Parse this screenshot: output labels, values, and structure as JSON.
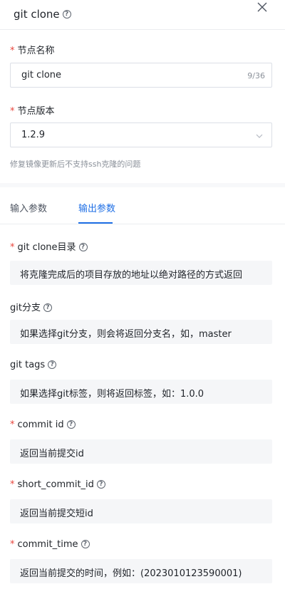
{
  "header": {
    "title": "git clone",
    "help_icon": "help-circle-icon",
    "close_icon": "close-icon"
  },
  "node_name": {
    "label": "节点名称",
    "value": "git clone",
    "count": "9/36"
  },
  "node_version": {
    "label": "节点版本",
    "value": "1.2.9",
    "hint": "修复镜像更新后不支持ssh克隆的问题"
  },
  "tabs": [
    {
      "label": "输入参数",
      "active": false
    },
    {
      "label": "输出参数",
      "active": true
    }
  ],
  "outputs": [
    {
      "label": "git clone目录",
      "required": true,
      "desc": "将克隆完成后的项目存放的地址以绝对路径的方式返回"
    },
    {
      "label": "git分支",
      "required": false,
      "desc": "如果选择git分支，则会将返回分支名，如，master"
    },
    {
      "label": "git tags",
      "required": false,
      "desc": "如果选择git标签，则将返回标签，如：1.0.0"
    },
    {
      "label": "commit id",
      "required": true,
      "desc": "返回当前提交id"
    },
    {
      "label": "short_commit_id",
      "required": true,
      "desc": "返回当前提交短id"
    },
    {
      "label": "commit_time",
      "required": true,
      "desc": "返回当前提交的时间，例如：(2023010123590001)"
    }
  ],
  "required_mark": "*",
  "help_glyph": "?",
  "colors": {
    "accent": "#1f6fe5",
    "required": "#e8453c",
    "param_bg": "#f5f6f8"
  }
}
